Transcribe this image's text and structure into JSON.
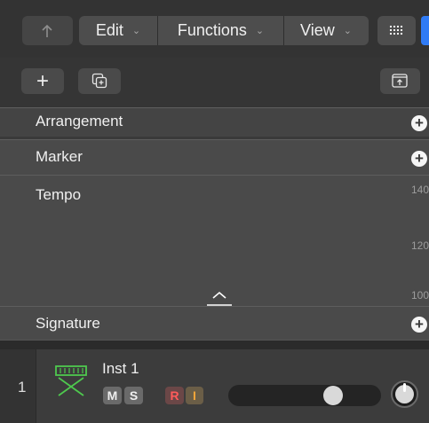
{
  "menubar": {
    "catch_icon": "catch-playhead-icon",
    "menus": [
      {
        "label": "Edit"
      },
      {
        "label": "Functions"
      },
      {
        "label": "View"
      }
    ],
    "chevron": "⌄",
    "grid_icon": "view-grid-icon",
    "accent": "#2f7bf5"
  },
  "toolbar2": {
    "add_symbol": "+",
    "dup_icon": "duplicate-track-icon",
    "export_icon": "export-icon"
  },
  "global_tracks": {
    "arrangement": "Arrangement",
    "marker": "Marker",
    "tempo": "Tempo",
    "tempo_ticks": [
      "140",
      "120",
      "100"
    ],
    "signature": "Signature",
    "add_symbol": "+"
  },
  "track": {
    "number": "1",
    "name": "Inst 1",
    "icon": "keyboard-instrument-icon",
    "mute": "M",
    "solo": "S",
    "record": "R",
    "input": "I",
    "volume_level": 0.72,
    "colors": {
      "record": "#ff5b5b",
      "input": "#f2a63a",
      "icon": "#4ec94e"
    }
  }
}
